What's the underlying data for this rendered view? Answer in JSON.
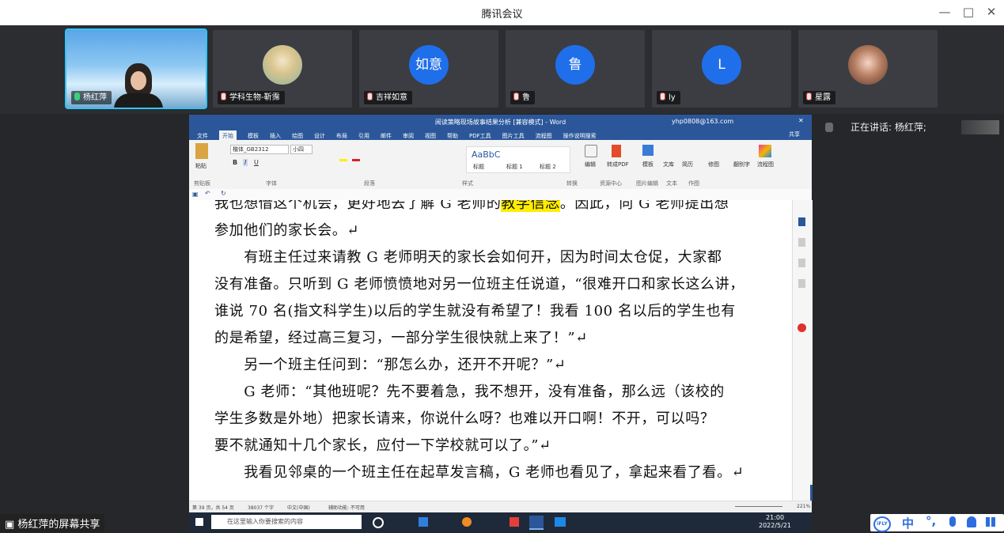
{
  "app_title": "腾讯会议",
  "window_controls": {
    "minimize": "—",
    "restore": "□",
    "close": "✕"
  },
  "participants": [
    {
      "name": "杨红萍",
      "type": "video",
      "active": true
    },
    {
      "name": "学科生物-靳霈",
      "type": "photo-avatar",
      "avatar_text": ""
    },
    {
      "name": "吉祥如意",
      "type": "text-avatar",
      "avatar_text": "如意"
    },
    {
      "name": "鲁",
      "type": "text-avatar",
      "avatar_text": "鲁"
    },
    {
      "name": "ly",
      "type": "text-avatar",
      "avatar_text": "L"
    },
    {
      "name": "星露",
      "type": "photo-avatar",
      "avatar_text": ""
    }
  ],
  "speaking": "正在讲话: 杨红萍;",
  "share_label": "杨红萍的屏幕共享",
  "word": {
    "title": "阅读策略现场故事结果分析 [兼容模式] - Word",
    "account": "yhp0808@163.com",
    "tabs": [
      "文件",
      "开始",
      "模板",
      "插入",
      "绘图",
      "设计",
      "布局",
      "引用",
      "邮件",
      "审阅",
      "视图",
      "帮助",
      "PDF工具",
      "图片工具",
      "流程图",
      "操作说明搜索"
    ],
    "share_btn": "共享",
    "ribbon": {
      "paste": "粘贴",
      "font_name": "楷体_GB2312",
      "font_size": "小四",
      "groups": [
        "剪贴板",
        "字体",
        "段落",
        "样式",
        "转换",
        "资源中心",
        "图片编辑",
        "文本",
        "作图"
      ],
      "styles": [
        "标题",
        "标题 1",
        "标题 2"
      ],
      "style_sample": "AaBbC",
      "tools": [
        "编辑",
        "转成PDF",
        "模板",
        "文库",
        "简历",
        "修图",
        "翻别字",
        "流程图"
      ]
    },
    "doc_lines": [
      {
        "pre": "我也想借这个机会，更好地去了解 G 老师的",
        "hl": "教学信念",
        "post": "。因此，向 G 老师提出想"
      },
      {
        "pre": "参加他们的家长会。↵",
        "hl": "",
        "post": ""
      },
      {
        "pre": "　　有班主任过来请教 G 老师明天的家长会如何开，因为时间太仓促，大家都",
        "hl": "",
        "post": ""
      },
      {
        "pre": "没有准备。只听到 G 老师愤愤地对另一位班主任说道，“很难开口和家长这么讲，",
        "hl": "",
        "post": ""
      },
      {
        "pre": "谁说 70 名(指文科学生)以后的学生就没有希望了！我看 100 名以后的学生也有",
        "hl": "",
        "post": ""
      },
      {
        "pre": "的是希望，经过高三复习，一部分学生很快就上来了！”↵",
        "hl": "",
        "post": ""
      },
      {
        "pre": "　　另一个班主任问到：“那怎么办，还开不开呢？”↵",
        "hl": "",
        "post": ""
      },
      {
        "pre": "　　G 老师：“其他班呢？先不要着急，我不想开，没有准备，那么远（该校的",
        "hl": "",
        "post": ""
      },
      {
        "pre": "学生多数是外地）把家长请来，你说什么呀？也难以开口啊！不开，可以吗？",
        "hl": "",
        "post": ""
      },
      {
        "pre": "要不就通知十几个家长，应付一下学校就可以了。”↵",
        "hl": "",
        "post": ""
      },
      {
        "pre": "　　我看见邻桌的一个班主任在起草发言稿，G 老师也看见了，拿起来看了看。↵",
        "hl": "",
        "post": ""
      }
    ],
    "status": {
      "page": "第 39 页，共 54 页",
      "words": "38037 个字",
      "lang": "中文(中国)",
      "accessibility": "辅助功能: 不可用",
      "zoom": "221%"
    }
  },
  "taskbar": {
    "search": "在这里输入你要搜索的内容",
    "time": "21:00",
    "date": "2022/5/21"
  },
  "ime": {
    "logo": "iFLY",
    "mode": "中",
    "punct": "°,"
  }
}
